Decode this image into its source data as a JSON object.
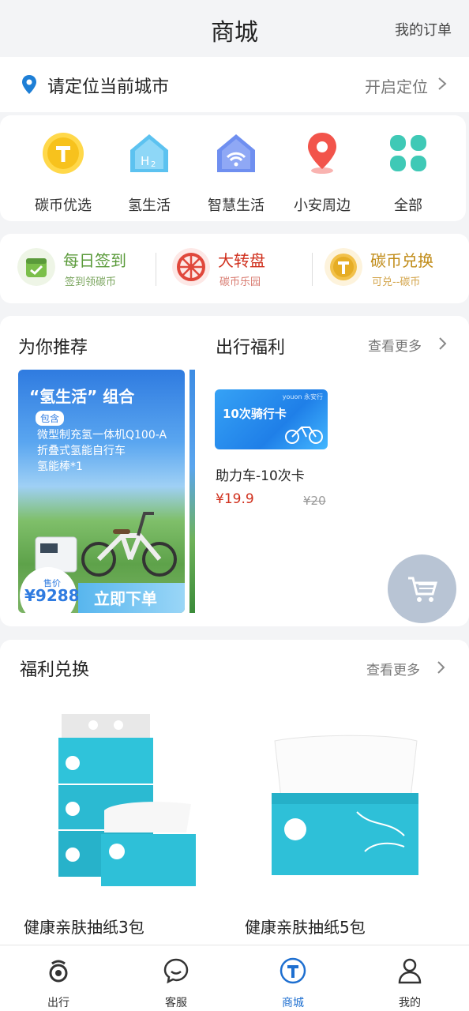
{
  "header": {
    "title": "商城",
    "orders_link": "我的订单"
  },
  "location": {
    "prompt": "请定位当前城市",
    "enable_label": "开启定位"
  },
  "categories": [
    {
      "label": "碳币优选",
      "icon": "carbon-coin-icon"
    },
    {
      "label": "氢生活",
      "icon": "hydrogen-house-icon"
    },
    {
      "label": "智慧生活",
      "icon": "wifi-house-icon"
    },
    {
      "label": "小安周边",
      "icon": "location-pin-icon"
    },
    {
      "label": "全部",
      "icon": "grid-all-icon"
    }
  ],
  "actions": [
    {
      "title": "每日签到",
      "subtitle": "签到领碳币",
      "color": "#5a9a3a"
    },
    {
      "title": "大转盘",
      "subtitle": "碳币乐园",
      "color": "#d0301d"
    },
    {
      "title": "碳币兑换",
      "subtitle": "可兑--碳币",
      "color": "#c08b17"
    }
  ],
  "recommend": {
    "title": "为你推荐",
    "banner": {
      "title": "“氢生活” 组合",
      "tag": "包含",
      "lines": [
        "微型制充氢一体机Q100-A",
        "折叠式氢能自行车",
        "氢能棒*1"
      ],
      "price_label": "售价",
      "price": "¥9288",
      "buy_label": "立即下单"
    }
  },
  "travel": {
    "title": "出行福利",
    "more_label": "查看更多",
    "card_text": "10次骑行卡",
    "card_brand": "youon 永安行",
    "item_name": "助力车-10次卡",
    "price": "¥19.9",
    "original_price": "¥20"
  },
  "welfare": {
    "title": "福利兑换",
    "more_label": "查看更多",
    "products": [
      {
        "name": "健康亲肤抽纸3包"
      },
      {
        "name": "健康亲肤抽纸5包"
      }
    ]
  },
  "tabs": [
    {
      "label": "出行",
      "icon": "ride-icon",
      "active": false
    },
    {
      "label": "客服",
      "icon": "chat-icon",
      "active": false
    },
    {
      "label": "商城",
      "icon": "mall-icon",
      "active": true
    },
    {
      "label": "我的",
      "icon": "user-icon",
      "active": false
    }
  ],
  "colors": {
    "accent": "#1e6fd0",
    "price": "#d0301d",
    "background": "#f3f4f6"
  }
}
